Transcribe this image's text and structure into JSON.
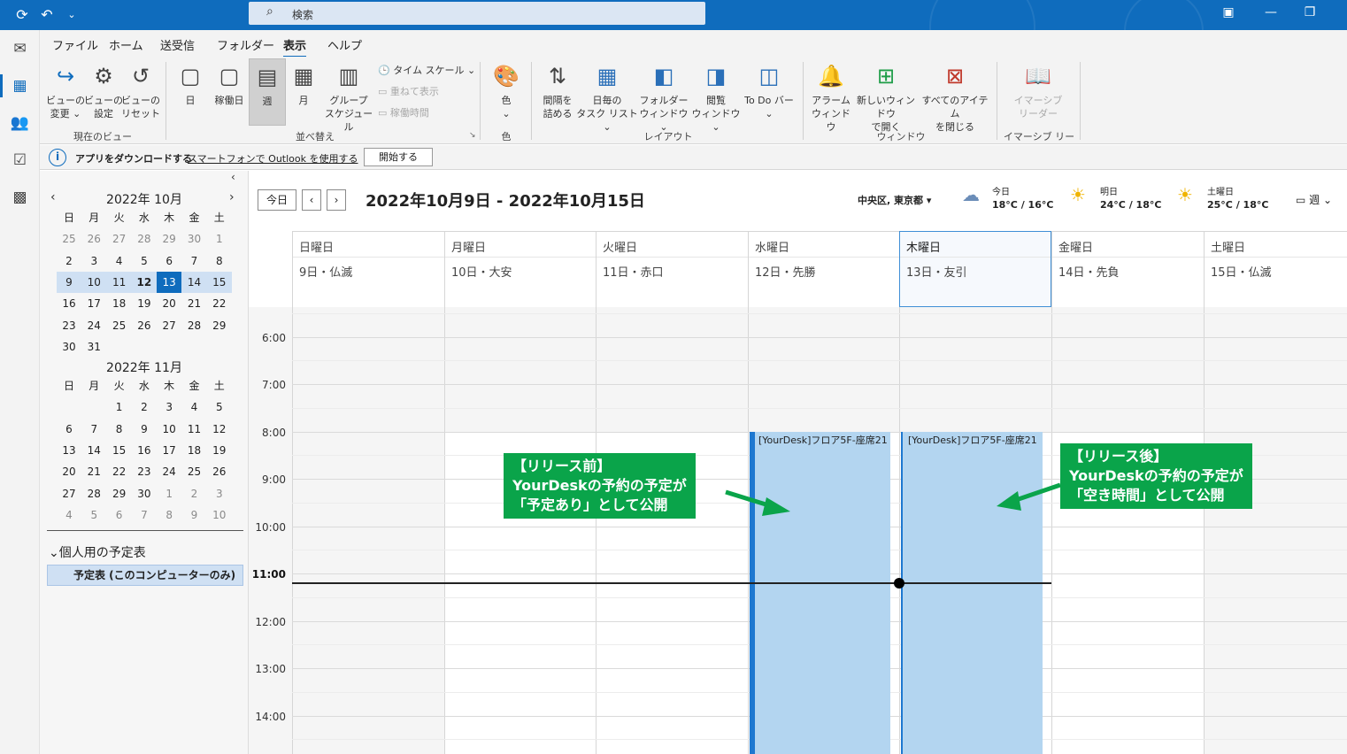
{
  "search": {
    "placeholder": "検索"
  },
  "menu": {
    "tabs": [
      "ファイル",
      "ホーム",
      "送受信",
      "フォルダー",
      "表示",
      "ヘルプ"
    ],
    "active": "表示"
  },
  "ribbon": {
    "view_change": [
      "ビューの",
      "変更 ⌄"
    ],
    "view_settings": [
      "ビューの",
      "設定"
    ],
    "view_reset": [
      "ビューの",
      "リセット"
    ],
    "group_current_view": "現在のビュー",
    "day": "日",
    "work_week": "稼働日",
    "week": "週",
    "month": "月",
    "group_schedule": [
      "グループ",
      "スケジュール"
    ],
    "timescale": "タイム スケール ⌄",
    "overlay": "重ねて表示",
    "work_hours": "稼働時間",
    "group_arrange": "並べ替え",
    "color": [
      "色",
      "⌄"
    ],
    "group_color": "色",
    "compact": [
      "間隔を",
      "詰める"
    ],
    "daily_task": [
      "日毎の",
      "タスク リスト ⌄"
    ],
    "folder_pane": [
      "フォルダー",
      "ウィンドウ ⌄"
    ],
    "reading_pane": [
      "閲覧",
      "ウィンドウ ⌄"
    ],
    "todo_bar": [
      "To Do バー",
      "⌄"
    ],
    "group_layout": "レイアウト",
    "alarm_window": [
      "アラーム",
      "ウィンドウ"
    ],
    "new_window": [
      "新しいウィンドウ",
      "で開く"
    ],
    "close_all": [
      "すべてのアイテム",
      "を閉じる"
    ],
    "group_window": "ウィンドウ",
    "immersive": [
      "イマーシブ",
      "リーダー"
    ],
    "group_immersive": "イマーシブ リーダー"
  },
  "infobar": {
    "title": "アプリをダウンロードする",
    "link": "スマートフォンで Outlook を使用する",
    "button": "開始する"
  },
  "minical": {
    "oct_title": "2022年 10月",
    "nov_title": "2022年 11月",
    "dow": [
      "日",
      "月",
      "火",
      "水",
      "木",
      "金",
      "土"
    ],
    "oct_weeks": [
      [
        "25",
        "26",
        "27",
        "28",
        "29",
        "30",
        "1"
      ],
      [
        "2",
        "3",
        "4",
        "5",
        "6",
        "7",
        "8"
      ],
      [
        "9",
        "10",
        "11",
        "12",
        "13",
        "14",
        "15"
      ],
      [
        "16",
        "17",
        "18",
        "19",
        "20",
        "21",
        "22"
      ],
      [
        "23",
        "24",
        "25",
        "26",
        "27",
        "28",
        "29"
      ],
      [
        "30",
        "31",
        "",
        "",
        "",
        "",
        ""
      ]
    ],
    "nov_weeks": [
      [
        "",
        "",
        "1",
        "2",
        "3",
        "4",
        "5"
      ],
      [
        "6",
        "7",
        "8",
        "9",
        "10",
        "11",
        "12"
      ],
      [
        "13",
        "14",
        "15",
        "16",
        "17",
        "18",
        "19"
      ],
      [
        "20",
        "21",
        "22",
        "23",
        "24",
        "25",
        "26"
      ],
      [
        "27",
        "28",
        "29",
        "30",
        "1",
        "2",
        "3"
      ],
      [
        "4",
        "5",
        "6",
        "7",
        "8",
        "9",
        "10"
      ]
    ]
  },
  "folders": {
    "header": "個人用の予定表",
    "item": "予定表 (このコンピューターのみ)"
  },
  "calendar": {
    "today_btn": "今日",
    "prev": "‹",
    "next": "›",
    "range": "2022年10月9日 - 2022年10月15日",
    "location": "中央区, 東京都",
    "weather": [
      {
        "label": "今日",
        "temp": "18°C / 16°C",
        "icon": "rain-cloud-icon"
      },
      {
        "label": "明日",
        "temp": "24°C / 18°C",
        "icon": "partly-sunny-icon"
      },
      {
        "label": "土曜日",
        "temp": "25°C / 18°C",
        "icon": "partly-sunny-icon"
      }
    ],
    "view_label": "週",
    "days": [
      {
        "name": "日曜日",
        "date": "9日・仏滅"
      },
      {
        "name": "月曜日",
        "date": "10日・大安"
      },
      {
        "name": "火曜日",
        "date": "11日・赤口"
      },
      {
        "name": "水曜日",
        "date": "12日・先勝"
      },
      {
        "name": "木曜日",
        "date": "13日・友引"
      },
      {
        "name": "金曜日",
        "date": "14日・先負"
      },
      {
        "name": "土曜日",
        "date": "15日・仏滅"
      }
    ],
    "times": [
      "6:00",
      "7:00",
      "8:00",
      "9:00",
      "10:00",
      "11:00",
      "12:00",
      "13:00",
      "14:00"
    ],
    "current_time": "11:00",
    "appointments": [
      {
        "day": "水曜日",
        "title": "[YourDesk]フロア5F-座席21",
        "status": "予定あり"
      },
      {
        "day": "木曜日",
        "title": "[YourDesk]フロア5F-座席21",
        "status": "空き時間"
      }
    ]
  },
  "callouts": {
    "before": [
      "【リリース前】",
      "YourDeskの予約の予定が",
      "「予定あり」として公開"
    ],
    "after": [
      "【リリース後】",
      "YourDeskの予約の予定が",
      "「空き時間」として公開"
    ]
  },
  "colors": {
    "accent": "#0f6cbd",
    "appointment": "#b3d5f0",
    "callout": "#0aa44a"
  }
}
